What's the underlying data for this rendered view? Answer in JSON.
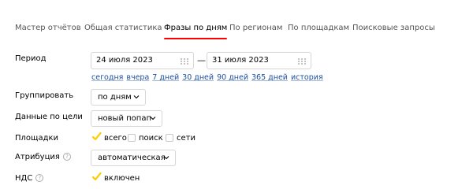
{
  "tabs": [
    {
      "label": "Мастер отчётов",
      "active": false
    },
    {
      "label": "Общая статистика",
      "active": false
    },
    {
      "label": "Фразы по дням",
      "active": true
    },
    {
      "label": "По регионам",
      "active": false
    },
    {
      "label": "По площадкам",
      "active": false
    },
    {
      "label": "Поисковые запросы",
      "active": false
    }
  ],
  "period": {
    "label": "Период",
    "date_from": "24 июля 2023",
    "date_to": "31 июля 2023",
    "separator": "—",
    "quick_links": [
      "сегодня",
      "вчера",
      "7 дней",
      "30 дней",
      "90 дней",
      "365 дней",
      "история"
    ]
  },
  "group": {
    "label": "Группировать",
    "value": "по дням"
  },
  "goal_data": {
    "label": "Данные по цели",
    "value": "новый попап"
  },
  "platforms": {
    "label": "Площадки",
    "options": [
      {
        "label": "всего",
        "checked": true
      },
      {
        "label": "поиск",
        "checked": false
      },
      {
        "label": "сети",
        "checked": false
      }
    ]
  },
  "attribution": {
    "label": "Атрибуция",
    "help": "?",
    "value": "автоматическая"
  },
  "vat": {
    "label": "НДС",
    "help": "?",
    "option_label": "включен",
    "checked": true
  },
  "colors": {
    "accent": "#ff0000",
    "link": "#1c4fa0",
    "check": "#ffcc00"
  }
}
